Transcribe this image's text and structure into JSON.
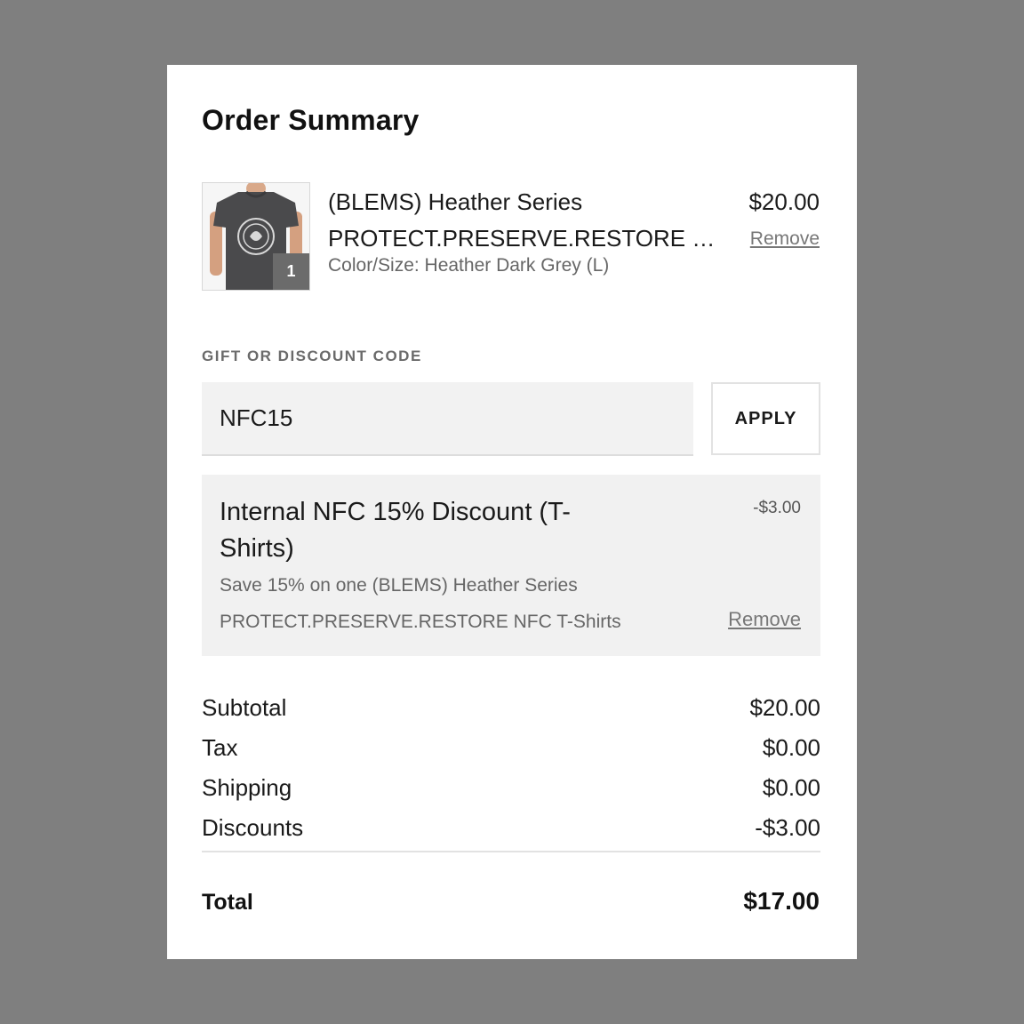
{
  "order_summary": {
    "title": "Order Summary",
    "item": {
      "name_line1": "(BLEMS) Heather Series",
      "name_line2": "PROTECT.PRESERVE.RESTORE NFC T-Shirts",
      "variant": "Color/Size: Heather Dark Grey (L)",
      "price": "$20.00",
      "quantity": "1",
      "remove_label": "Remove",
      "image_icon": "tshirt-image",
      "shirt_color": "#4a4a4c"
    },
    "discount_code": {
      "label": "GIFT OR DISCOUNT CODE",
      "value": "NFC15",
      "apply_label": "APPLY"
    },
    "applied_discount": {
      "name": "Internal NFC 15% Discount (T-Shirts)",
      "amount": "-$3.00",
      "description_line1": "Save 15% on one (BLEMS) Heather Series",
      "description_line2": "PROTECT.PRESERVE.RESTORE NFC T-Shirts",
      "remove_label": "Remove"
    },
    "totals": {
      "subtotal_label": "Subtotal",
      "subtotal_value": "$20.00",
      "tax_label": "Tax",
      "tax_value": "$0.00",
      "shipping_label": "Shipping",
      "shipping_value": "$0.00",
      "discounts_label": "Discounts",
      "discounts_value": "-$3.00",
      "total_label": "Total",
      "total_value": "$17.00"
    }
  }
}
